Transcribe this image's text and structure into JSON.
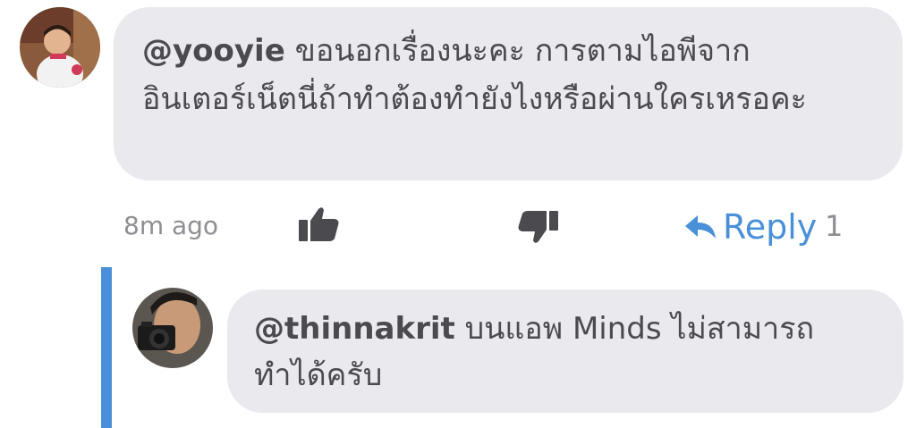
{
  "comment": {
    "author_mention": "@yooyie",
    "text": " ขอนอกเรื่องนะคะ การตามไอพีจากอินเตอร์เน็ตนี่ถ้าทำต้องทำยังไงหรือผ่านใครเหรอคะ",
    "time": "8m ago",
    "like_icon": "thumbs-up-icon",
    "dislike_icon": "thumbs-down-icon",
    "reply_label": "Reply",
    "reply_icon": "reply-arrow-icon",
    "reply_count": "1"
  },
  "reply": {
    "author_mention": "@thinnakrit",
    "text": " บนแอพ Minds ไม่สามารถทำได้ครับ"
  },
  "colors": {
    "bubble": "#e9e9ee",
    "text": "#4a4a4f",
    "accent": "#4a90d9",
    "muted": "#8e8e93"
  }
}
